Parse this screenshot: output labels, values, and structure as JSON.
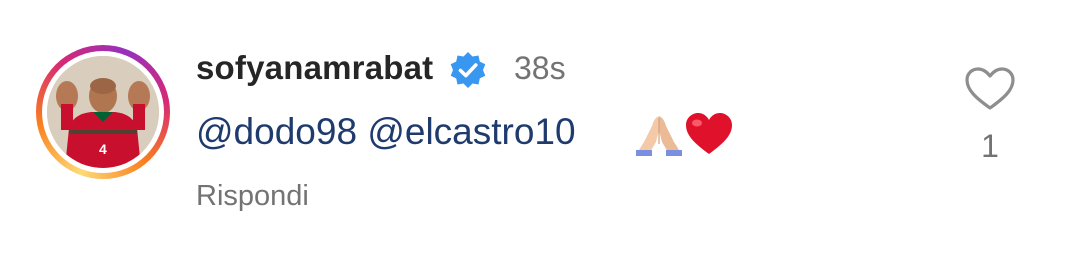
{
  "comment": {
    "username": "sofyanamrabat",
    "verified": true,
    "timestamp": "38s",
    "mentions": [
      "@dodo98",
      "@elcastro10"
    ],
    "emojis": [
      "folded-hands",
      "red-heart"
    ],
    "reply_label": "Rispondi",
    "like_count": "1",
    "avatar": {
      "jersey_number": "4"
    }
  },
  "colors": {
    "verified_badge": "#3897f0",
    "mention_text": "#1f3b6e",
    "secondary_text": "#737373",
    "primary_text": "#262626",
    "jersey_red": "#c8102e",
    "jersey_green": "#006233"
  },
  "icons": {
    "verified": "verified-badge-icon",
    "like": "heart-outline-icon"
  }
}
